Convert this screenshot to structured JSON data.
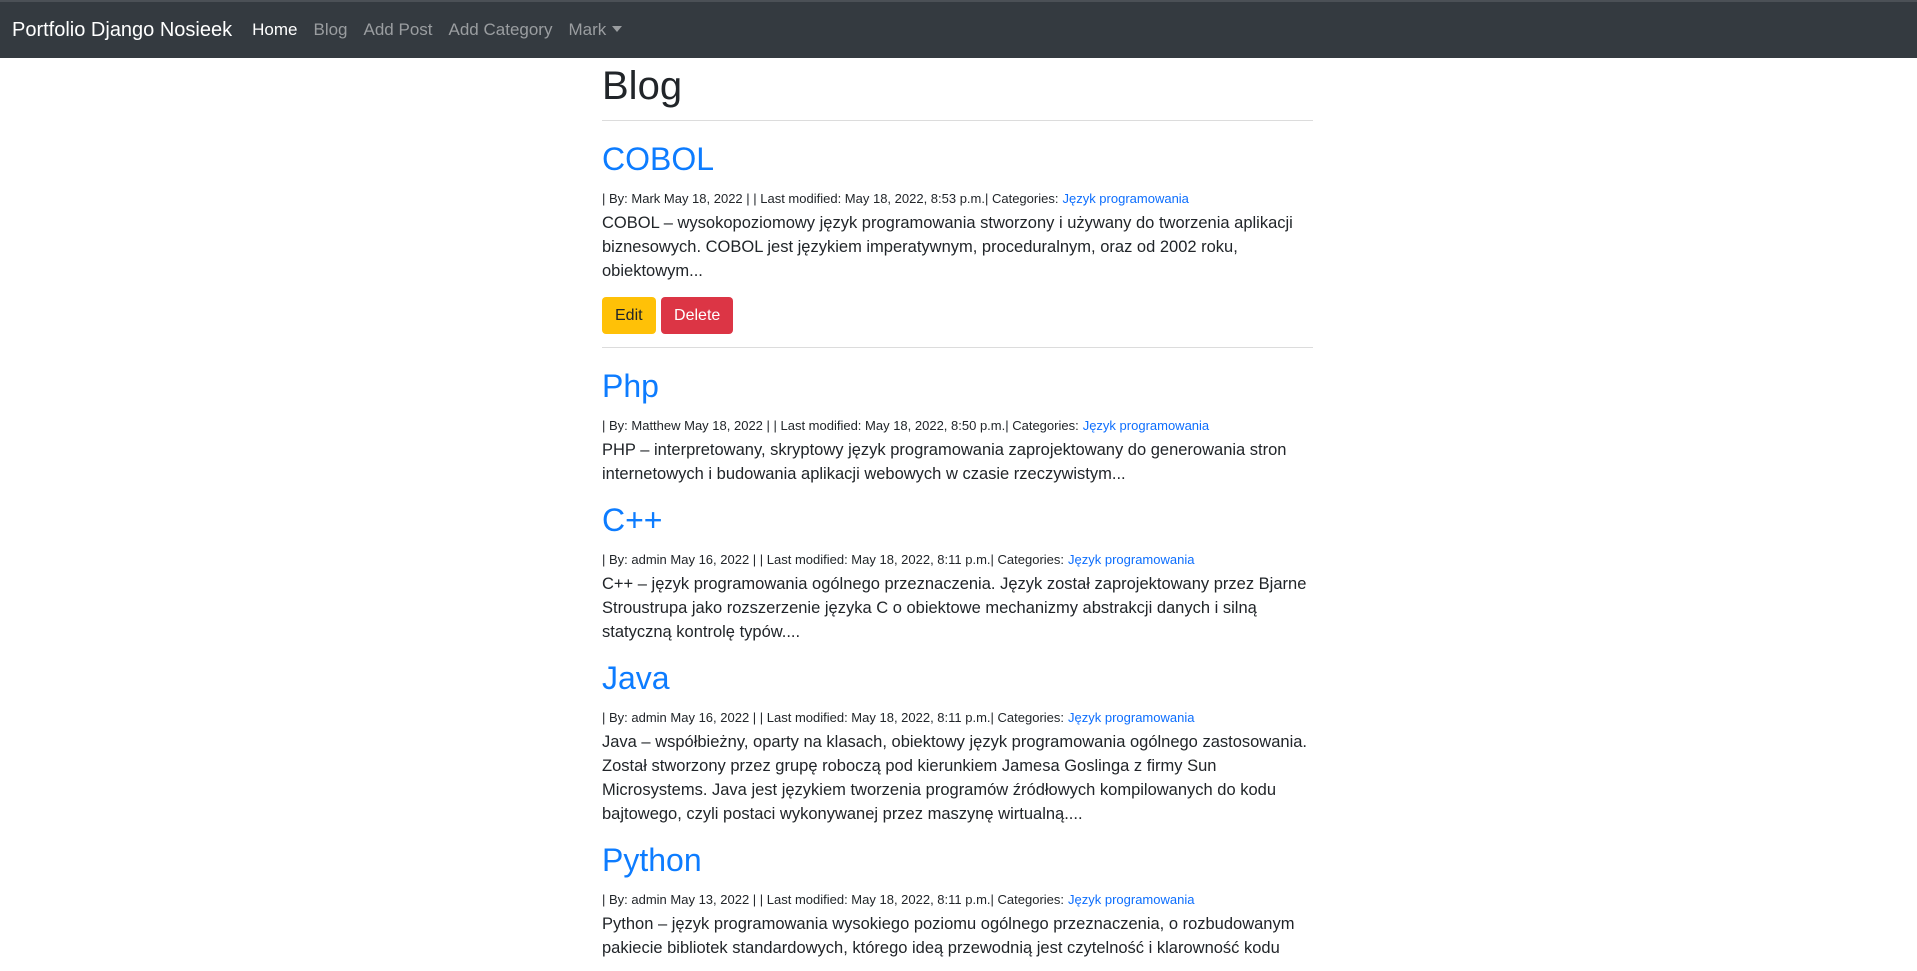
{
  "navbar": {
    "brand": "Portfolio Django Nosieek",
    "links": [
      "Home",
      "Blog",
      "Add Post",
      "Add Category"
    ],
    "user_menu": "Mark"
  },
  "page": {
    "title": "Blog"
  },
  "posts": [
    {
      "title": "COBOL",
      "meta": "| By: Mark May 18, 2022 |  | Last modified: May 18, 2022, 8:53 p.m.| Categories:",
      "category": "Język programowania",
      "snippet": "COBOL – wysokopoziomowy język programowania stworzony i używany do tworzenia aplikacji biznesowych. COBOL jest językiem imperatywnym, proceduralnym, oraz od 2002 roku, obiektowym..."
    },
    {
      "title": "Php",
      "meta": "| By: Matthew May 18, 2022 |  | Last modified: May 18, 2022, 8:50 p.m.| Categories:",
      "category": "Język programowania",
      "snippet": "PHP – interpretowany, skryptowy język programowania zaprojektowany do generowania stron internetowych i budowania aplikacji webowych w czasie rzeczywistym..."
    },
    {
      "title": "C++",
      "meta": "| By: admin May 16, 2022 |  | Last modified: May 18, 2022, 8:11 p.m.| Categories:",
      "category": "Język programowania",
      "snippet": "C++ – język programowania ogólnego przeznaczenia. Język został zaprojektowany przez Bjarne Stroustrupa jako rozszerzenie języka C o obiektowe mechanizmy abstrakcji danych i silną statyczną kontrolę typów...."
    },
    {
      "title": "Java",
      "meta": "| By: admin May 16, 2022 |  | Last modified: May 18, 2022, 8:11 p.m.| Categories:",
      "category": "Język programowania",
      "snippet": "Java – współbieżny, oparty na klasach, obiektowy język programowania ogólnego zastosowania. Został stworzony przez grupę roboczą pod kierunkiem Jamesa Goslinga z firmy Sun Microsystems. Java jest językiem tworzenia programów źródłowych kompilowanych do kodu bajtowego, czyli postaci wykonywanej przez maszynę wirtualną...."
    },
    {
      "title": "Python",
      "meta": "| By: admin May 13, 2022 |  | Last modified: May 18, 2022, 8:11 p.m.| Categories:",
      "category": "Język programowania",
      "snippet": "Python – język programowania wysokiego poziomu ogólnego przeznaczenia, o rozbudowanym pakiecie bibliotek standardowych, którego ideą przewodnią jest czytelność i klarowność kodu"
    }
  ],
  "actions": {
    "edit_label": "Edit",
    "delete_label": "Delete"
  }
}
